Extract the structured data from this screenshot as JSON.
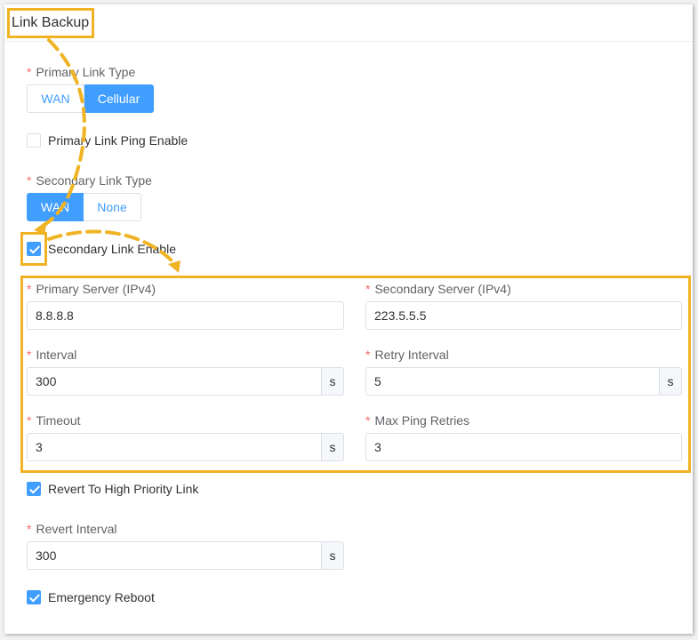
{
  "panel": {
    "title": "Link Backup"
  },
  "primary_link_type": {
    "label": "Primary Link Type",
    "options": [
      "WAN",
      "Cellular"
    ],
    "selected": "Cellular"
  },
  "primary_ping": {
    "label": "Primary Link Ping Enable",
    "checked": false
  },
  "secondary_link_type": {
    "label": "Secondary Link Type",
    "options": [
      "WAN",
      "None"
    ],
    "selected": "WAN"
  },
  "secondary_enable": {
    "label": "Secondary Link Enable",
    "checked": true
  },
  "ping": {
    "primary_server": {
      "label": "Primary Server (IPv4)",
      "value": "8.8.8.8"
    },
    "secondary_server": {
      "label": "Secondary Server (IPv4)",
      "value": "223.5.5.5"
    },
    "interval": {
      "label": "Interval",
      "value": "300",
      "unit": "s"
    },
    "retry_interval": {
      "label": "Retry Interval",
      "value": "5",
      "unit": "s"
    },
    "timeout": {
      "label": "Timeout",
      "value": "3",
      "unit": "s"
    },
    "max_ping_retries": {
      "label": "Max Ping Retries",
      "value": "3"
    }
  },
  "revert": {
    "label": "Revert To High Priority Link",
    "checked": true
  },
  "revert_interval": {
    "label": "Revert Interval",
    "value": "300",
    "unit": "s"
  },
  "emergency_reboot": {
    "label": "Emergency Reboot",
    "checked": true
  },
  "required_mark": "*",
  "colors": {
    "accent": "#409eff",
    "highlight": "#f0b323",
    "required": "#f56c6c"
  }
}
